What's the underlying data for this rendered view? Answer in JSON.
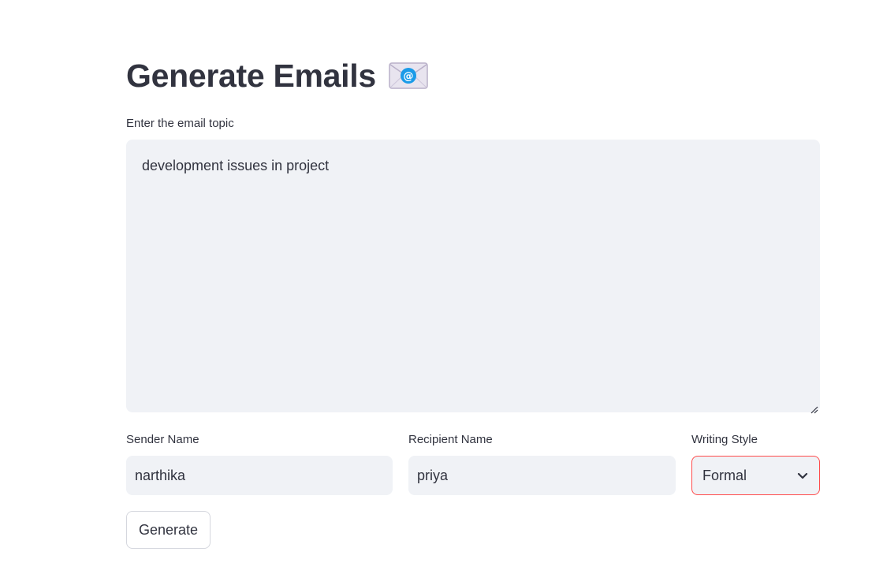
{
  "header": {
    "title": "Generate Emails",
    "title_icon": "envelope-with-at-icon"
  },
  "topic": {
    "label": "Enter the email topic",
    "value": "development issues in project"
  },
  "sender": {
    "label": "Sender Name",
    "value": "narthika"
  },
  "recipient": {
    "label": "Recipient Name",
    "value": "priya"
  },
  "writing_style": {
    "label": "Writing Style",
    "selected": "Formal",
    "icon": "chevron-down-icon"
  },
  "actions": {
    "generate_label": "Generate"
  },
  "colors": {
    "text": "#31333f",
    "input_background": "#f0f2f6",
    "focus_border": "#ff4b4b",
    "button_border": "#d5d7de"
  }
}
